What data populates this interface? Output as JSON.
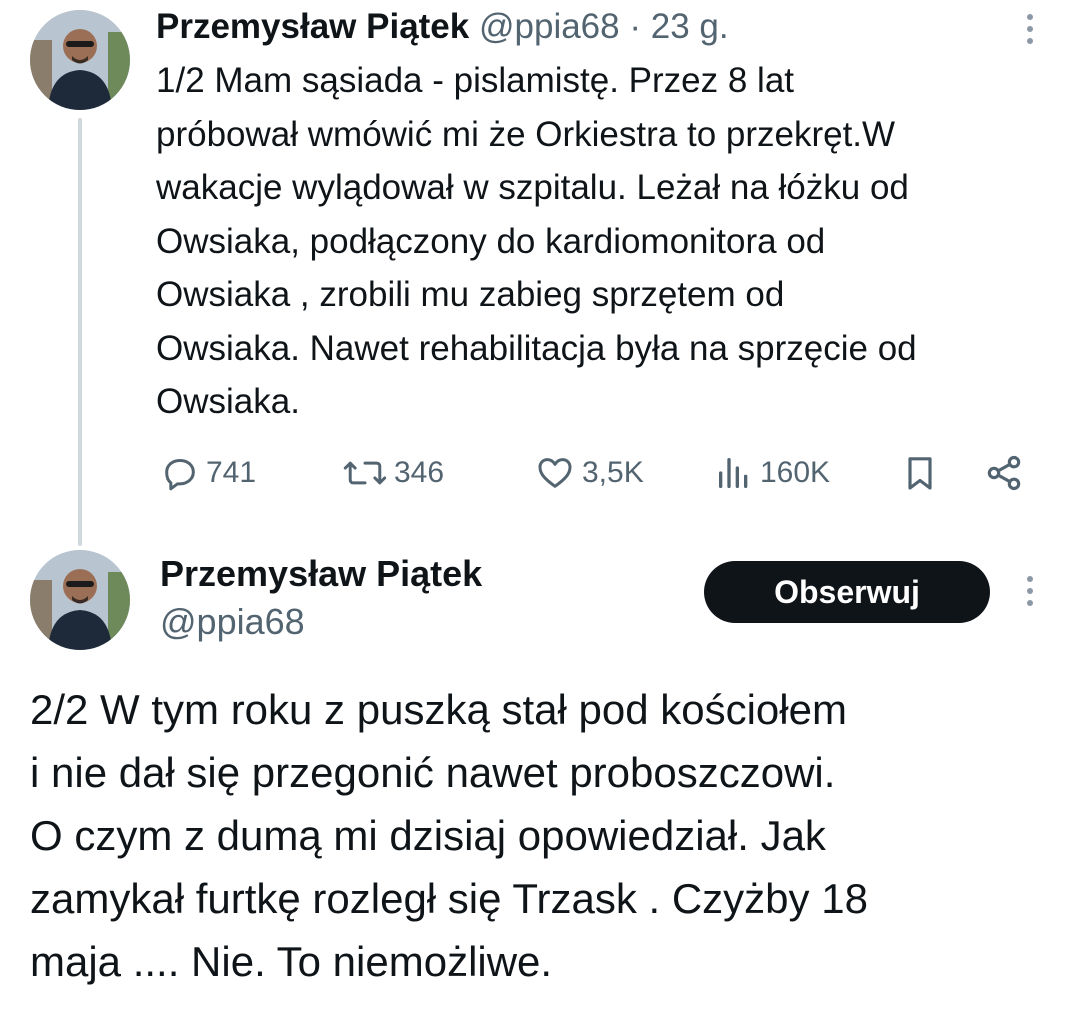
{
  "tweet1": {
    "author_name": "Przemysław Piątek",
    "handle": "@ppia68",
    "separator": "·",
    "time": "23 g.",
    "text_lines": [
      "1/2 Mam sąsiada - pislamistę. Przez 8 lat",
      "próbował wmówić mi że Orkiestra to przekręt.W",
      "wakacje wylądował w szpitalu. Leżał na łóżku od",
      "Owsiaka, podłączony do kardiomonitora od",
      "Owsiaka , zrobili mu zabieg sprzętem od",
      "Owsiaka. Nawet rehabilitacja była na sprzęcie od",
      "Owsiaka."
    ],
    "actions": {
      "replies": "741",
      "reposts": "346",
      "likes": "3,5K",
      "views": "160K"
    }
  },
  "tweet2": {
    "author_name": "Przemysław Piątek",
    "handle": "@ppia68",
    "follow_label": "Obserwuj",
    "text_lines": [
      "2/2 W tym roku z puszką stał pod kościołem",
      "i nie dał się przegonić nawet proboszczowi.",
      "O czym z dumą mi dzisiaj opowiedział. Jak",
      "zamykał furtkę rozległ się Trzask . Czyżby 18",
      "maja .... Nie. To niemożliwe."
    ]
  },
  "icons": {
    "reply": "speech-bubble-icon",
    "repost": "repost-arrows-icon",
    "like": "heart-icon",
    "views": "bar-chart-icon",
    "bookmark": "bookmark-icon",
    "share": "share-icon",
    "more": "vertical-dots-icon"
  },
  "colors": {
    "text": "#0f1419",
    "secondary": "#536471",
    "thread_line": "#cfd9de",
    "follow_bg": "#0f1419"
  }
}
